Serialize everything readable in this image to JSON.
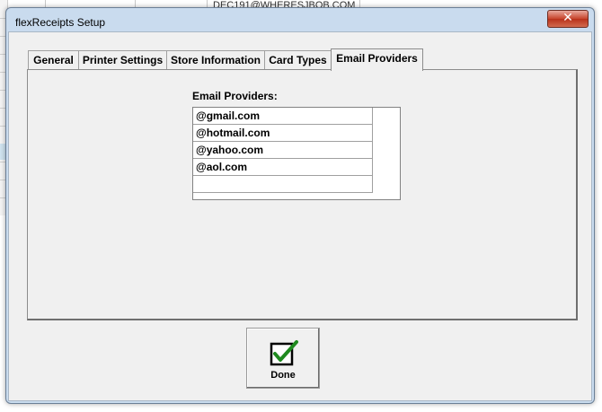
{
  "background": {
    "email_text": "DEC191@WHERESJBOB.COM"
  },
  "window": {
    "title": "flexReceipts Setup",
    "close_glyph": "✕"
  },
  "tabs": [
    {
      "label": "General",
      "active": false
    },
    {
      "label": "Printer Settings",
      "active": false
    },
    {
      "label": "Store Information",
      "active": false
    },
    {
      "label": "Card Types",
      "active": false
    },
    {
      "label": "Email Providers",
      "active": true
    }
  ],
  "email_providers": {
    "label": "Email Providers:",
    "items": [
      "@gmail.com",
      "@hotmail.com",
      "@yahoo.com",
      "@aol.com",
      ""
    ]
  },
  "done_button": {
    "label": "Done",
    "icon": "checkmark-icon",
    "check_color": "#1f8a1f"
  }
}
